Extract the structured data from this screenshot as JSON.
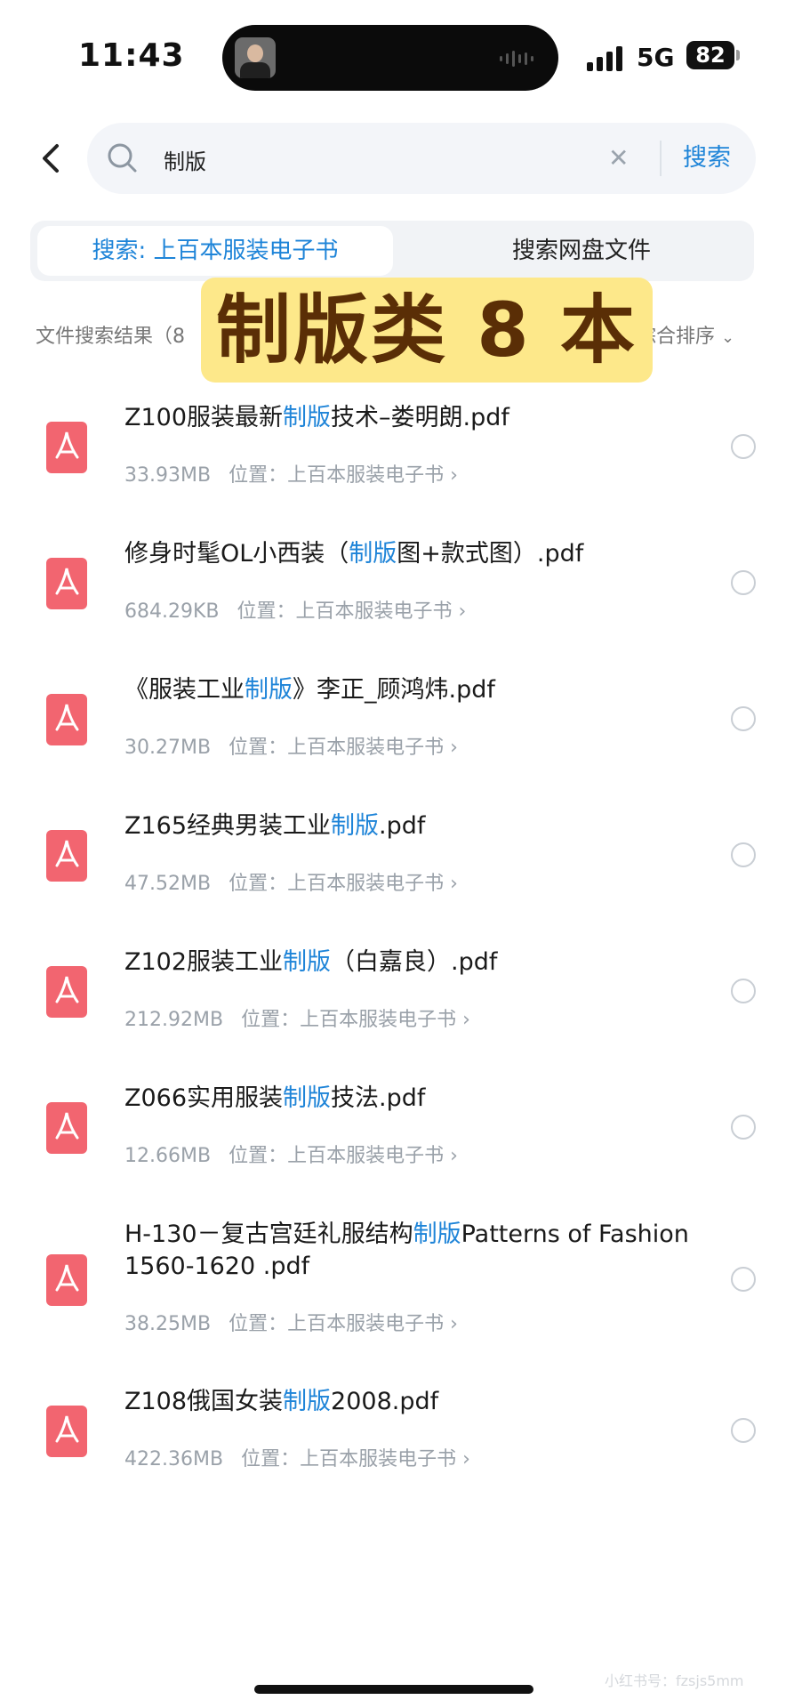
{
  "status": {
    "time": "11:43",
    "network": "5G",
    "battery": "82"
  },
  "search": {
    "query": "制版",
    "submit": "搜索"
  },
  "tabs": {
    "active": "搜索: 上百本服装电子书",
    "other": "搜索网盘文件"
  },
  "results_header": {
    "count_label": "文件搜索结果（8",
    "sort_label": "综合排序"
  },
  "banner": "制版类 8 本",
  "location_prefix": "位置：",
  "items": [
    {
      "title_pre": "Z100服装最新",
      "hl": "制版",
      "title_post": "技术–娄明朗.pdf",
      "size": "33.93MB",
      "location": "上百本服装电子书"
    },
    {
      "title_pre": "修身时髦OL小西装（",
      "hl": "制版",
      "title_post": "图+款式图）.pdf",
      "size": "684.29KB",
      "location": "上百本服装电子书"
    },
    {
      "title_pre": "《服装工业",
      "hl": "制版",
      "title_post": "》李正_顾鸿炜.pdf",
      "size": "30.27MB",
      "location": "上百本服装电子书"
    },
    {
      "title_pre": "Z165经典男装工业",
      "hl": "制版",
      "title_post": ".pdf",
      "size": "47.52MB",
      "location": "上百本服装电子书"
    },
    {
      "title_pre": "Z102服装工业",
      "hl": "制版",
      "title_post": "（白嘉良）.pdf",
      "size": "212.92MB",
      "location": "上百本服装电子书"
    },
    {
      "title_pre": "Z066实用服装",
      "hl": "制版",
      "title_post": "技法.pdf",
      "size": "12.66MB",
      "location": "上百本服装电子书"
    },
    {
      "title_pre": "H-130－复古宫廷礼服结构",
      "hl": "制版",
      "title_post": "Patterns of Fashion 1560-1620 .pdf",
      "size": "38.25MB",
      "location": "上百本服装电子书"
    },
    {
      "title_pre": "Z108俄国女装",
      "hl": "制版",
      "title_post": "2008.pdf",
      "size": "422.36MB",
      "location": "上百本服装电子书"
    }
  ],
  "watermark": "小红书号：fzsjs5mm"
}
